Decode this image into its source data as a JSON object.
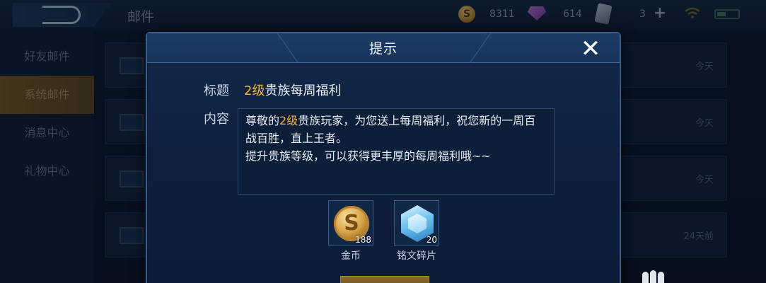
{
  "header": {
    "title": "邮件",
    "coins": "8311",
    "gems": "614",
    "cards": "3",
    "coin_icon": "S"
  },
  "sidebar": {
    "items": [
      {
        "label": "好友邮件"
      },
      {
        "label": "系统邮件"
      },
      {
        "label": "消息中心"
      },
      {
        "label": "礼物中心"
      }
    ]
  },
  "mail_list": {
    "rows": [
      {
        "date": "今天"
      },
      {
        "date": "今天"
      },
      {
        "date": "今天"
      },
      {
        "date": "24天前"
      }
    ]
  },
  "dialog": {
    "title": "提示",
    "close_icon": "✕",
    "subject_label": "标题",
    "subject_level": "2级",
    "subject_rest": "贵族每周福利",
    "content_label": "内容",
    "content_pre": "尊敬的",
    "content_level": "2级",
    "content_line1_rest": "贵族玩家，为您送上每周福利，祝您新的一周百战百胜，直上王者。",
    "content_line2": "提升贵族等级，可以获得更丰厚的每周福利哦~~",
    "rewards": [
      {
        "name": "金币",
        "qty": "188",
        "icon": "gold-coin"
      },
      {
        "name": "铭文碎片",
        "qty": "20",
        "icon": "rune-shard"
      }
    ]
  },
  "colors": {
    "accent_gold": "#f0b43a",
    "dialog_border": "#3a5f8c",
    "active_tab": "#7a5a26"
  }
}
